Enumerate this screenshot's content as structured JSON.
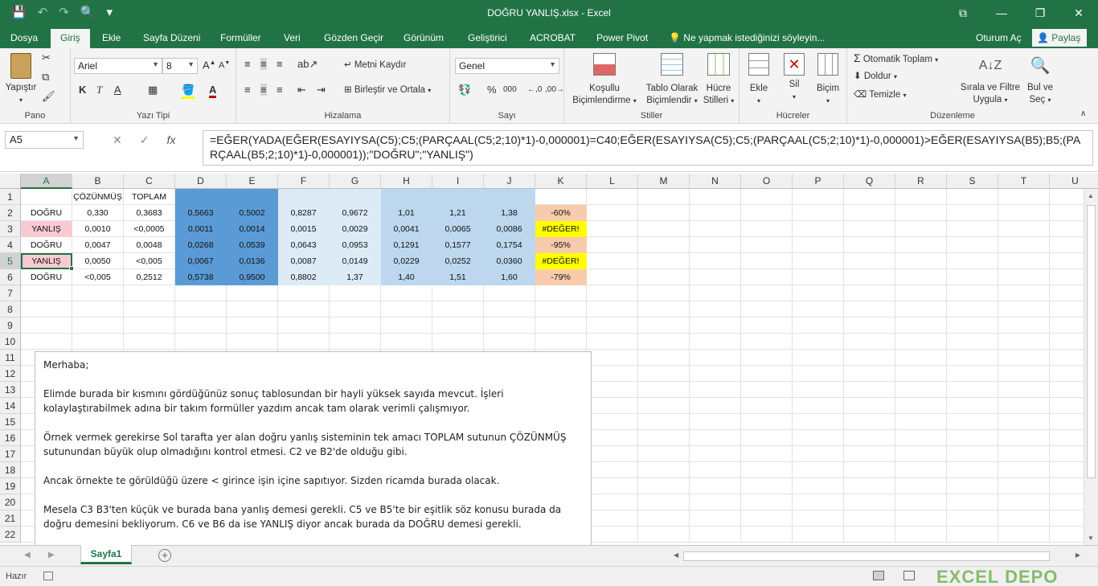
{
  "window": {
    "title": "DOĞRU YANLIŞ.xlsx - Excel",
    "controls": [
      "⧉",
      "—",
      "❐",
      "✕"
    ]
  },
  "qat": {
    "save": "💾",
    "undo": "↶",
    "redo": "↷",
    "preview": "🔍",
    "more": "▾"
  },
  "tabs": [
    "Dosya",
    "Giriş",
    "Ekle",
    "Sayfa Düzeni",
    "Formüller",
    "Veri",
    "Gözden Geçir",
    "Görünüm",
    "Geliştirici",
    "ACROBAT",
    "Power Pivot"
  ],
  "active_tab": "Giriş",
  "tell_me": "Ne yapmak istediğinizi söyleyin...",
  "sign_in": "Oturum Aç",
  "share": "Paylaş",
  "ribbon": {
    "clipboard": {
      "paste": "Yapıştır",
      "label": "Pano"
    },
    "font": {
      "name": "Ariel",
      "size": "8",
      "label": "Yazı Tipi",
      "bold": "K",
      "italic": "T",
      "underline": "A"
    },
    "alignment": {
      "wrap": "Metni Kaydır",
      "merge": "Birleştir ve Ortala",
      "label": "Hizalama"
    },
    "number": {
      "format": "Genel",
      "label": "Sayı",
      "percent": "%",
      "comma": "000"
    },
    "styles": {
      "conditional": "Koşullu",
      "conditional2": "Biçimlendirme",
      "table": "Tablo Olarak",
      "table2": "Biçimlendir",
      "cell": "Hücre",
      "cell2": "Stilleri",
      "label": "Stiller"
    },
    "cells": {
      "insert": "Ekle",
      "delete": "Sil",
      "format": "Biçim",
      "label": "Hücreler"
    },
    "editing": {
      "autosum": "Otomatik Toplam",
      "fill": "Doldur",
      "clear": "Temizle",
      "sort": "Sırala ve Filtre",
      "sort2": "Uygula",
      "find": "Bul ve",
      "find2": "Seç",
      "label": "Düzenleme"
    }
  },
  "formula_bar": {
    "name_box": "A5",
    "fx": "fx",
    "formula": "=EĞER(YADA(EĞER(ESAYIYSA(C5);C5;(PARÇAAL(C5;2;10)*1)-0,000001)=C40;EĞER(ESAYIYSA(C5);C5;(PARÇAAL(C5;2;10)*1)-0,000001)>EĞER(ESAYIYSA(B5);B5;(PARÇAAL(B5;2;10)*1)-0,000001));\"DOĞRU\";\"YANLIŞ\")"
  },
  "columns": [
    "A",
    "B",
    "C",
    "D",
    "E",
    "F",
    "G",
    "H",
    "I",
    "J",
    "K",
    "L",
    "M",
    "N",
    "O",
    "P",
    "Q",
    "R",
    "S",
    "T",
    "U"
  ],
  "rows": [
    "1",
    "2",
    "3",
    "4",
    "5",
    "6",
    "7",
    "8",
    "9",
    "10",
    "11",
    "12",
    "13",
    "14",
    "15",
    "16",
    "17",
    "18",
    "19",
    "20",
    "21",
    "22"
  ],
  "table": [
    [
      "",
      "ÇÖZÜNMÜŞ",
      "TOPLAM",
      "",
      "",
      "",
      "",
      "",
      "",
      "",
      ""
    ],
    [
      "DOĞRU",
      "0,330",
      "0,3683",
      "0,5663",
      "0,5002",
      "0,8287",
      "0,9672",
      "1,01",
      "1,21",
      "1,38",
      "-60%"
    ],
    [
      "YANLIŞ",
      "0,0010",
      "<0,0005",
      "0,0011",
      "0,0014",
      "0,0015",
      "0,0029",
      "0,0041",
      "0,0065",
      "0,0086",
      "#DEĞER!"
    ],
    [
      "DOĞRU",
      "0,0047",
      "0,0048",
      "0,0268",
      "0,0539",
      "0,0643",
      "0,0953",
      "0,1291",
      "0,1577",
      "0,1754",
      "-95%"
    ],
    [
      "YANLIŞ",
      "0,0050",
      "<0,005",
      "0,0067",
      "0,0136",
      "0,0087",
      "0,0149",
      "0,0229",
      "0,0252",
      "0,0360",
      "#DEĞER!"
    ],
    [
      "DOĞRU",
      "<0,005",
      "0,2512",
      "0,5738",
      "0,9500",
      "0,8802",
      "1,37",
      "1,40",
      "1,51",
      "1,60",
      "-79%"
    ]
  ],
  "colors": {
    "excel_green": "#217346",
    "fill_DE": "#5b9bd5",
    "fill_FG": "#ddebf7",
    "fill_HIJ": "#bdd7ee",
    "fill_pink": "#f8cbd3",
    "fill_yellow": "#ffff00",
    "fill_K_pink": "#f8cbad"
  },
  "textbox": {
    "greeting": "Merhaba;",
    "p1": "Elimde burada bir kısmını gördüğünüz sonuç tablosundan bir hayli yüksek sayıda mevcut. İşleri kolaylaştırabilmek adına bir takım formüller yazdım ancak tam olarak verimli çalışmıyor.",
    "p2": "Örnek vermek gerekirse Sol tarafta yer alan doğru yanlış sisteminin tek amacı TOPLAM sutunun ÇÖZÜNMÜŞ sutunundan büyük olup olmadığını kontrol etmesi. C2 ve B2'de olduğu gibi.",
    "p3": "Ancak örnekte te görüldüğü üzere < girince işin içine sapıtıyor. Sizden ricamda burada olacak.",
    "p4": "Mesela C3 B3'ten küçük ve burada bana yanlış demesi gerekli. C5 ve B5'te bir eşitlik söz konusu burada da doğru demesini bekliyorum. C6 ve B6 da ise YANLIŞ diyor ancak burada da DOĞRU demesi gerekli."
  },
  "sheet_tab": "Sayfa1",
  "status": "Hazır",
  "watermark": "EXCEL DEPO"
}
